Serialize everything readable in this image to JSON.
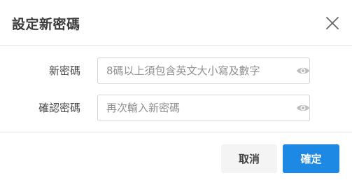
{
  "dialog": {
    "title": "設定新密碼"
  },
  "fields": [
    {
      "label": "新密碼",
      "value": "",
      "placeholder": "8碼以上須包含英文大小寫及數字",
      "icon": "eye-icon"
    },
    {
      "label": "確認密碼",
      "value": "",
      "placeholder": "再次輸入新密碼",
      "icon": "eye-icon"
    }
  ],
  "buttons": {
    "cancel_label": "取消",
    "confirm_label": "確定"
  },
  "colors": {
    "accent": "#1e88e5",
    "border": "#d6d6d6",
    "title_text": "#3a3a3a",
    "icon": "#bdbdbd"
  }
}
